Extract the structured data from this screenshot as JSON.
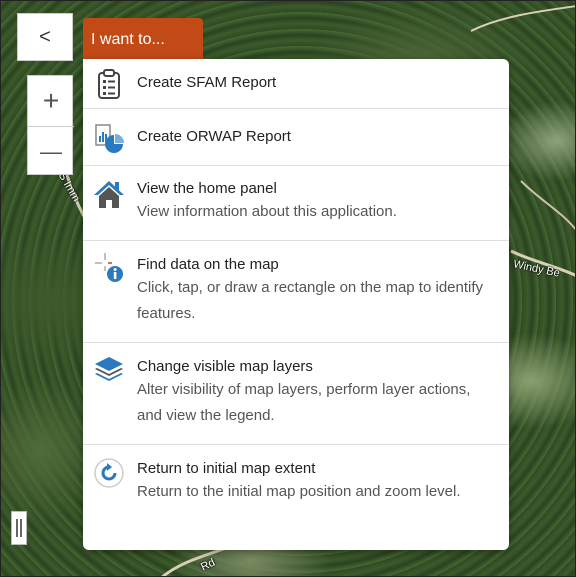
{
  "controls": {
    "back_label": "<",
    "zoom_in_label": "+",
    "zoom_out_label": "—"
  },
  "menu_tab": {
    "label": "I want to..."
  },
  "menu": {
    "items": [
      {
        "icon": "clipboard-report-icon",
        "title": "Create SFAM Report",
        "description": ""
      },
      {
        "icon": "chart-report-icon",
        "title": "Create ORWAP Report",
        "description": ""
      },
      {
        "icon": "home-icon",
        "title": "View the home panel",
        "description": "View information about this application."
      },
      {
        "icon": "identify-info-icon",
        "title": "Find data on the map",
        "description": "Click, tap, or draw a rectangle on the map to identify features."
      },
      {
        "icon": "layers-icon",
        "title": "Change visible map layers",
        "description": "Alter visibility of map layers, perform layer actions, and view the legend."
      },
      {
        "icon": "refresh-extent-icon",
        "title": "Return to initial map extent",
        "description": "Return to the initial map position and zoom level."
      }
    ]
  },
  "map_labels": {
    "road_1": "S Imm",
    "road_2": "Windy Be",
    "road_3": "Rd"
  },
  "colors": {
    "accent": "#c24a17",
    "icon_blue": "#2a7ac0"
  }
}
